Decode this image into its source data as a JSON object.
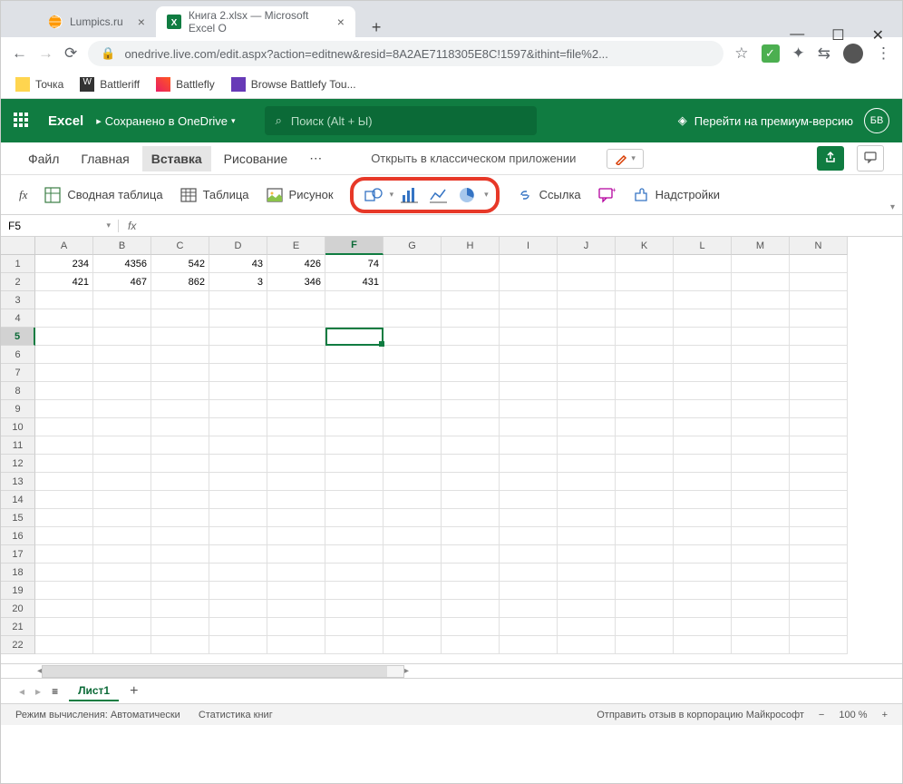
{
  "browser": {
    "tabs": [
      {
        "title": "Lumpics.ru",
        "active": false
      },
      {
        "title": "Книга 2.xlsx — Microsoft Excel O",
        "active": true
      }
    ],
    "url": "onedrive.live.com/edit.aspx?action=editnew&resid=8A2AE7118305E8C!1597&ithint=file%2...",
    "bookmarks": [
      {
        "label": "Точка"
      },
      {
        "label": "Battleriff"
      },
      {
        "label": "Battlefly"
      },
      {
        "label": "Browse Battlefy Tou..."
      }
    ]
  },
  "excel": {
    "app_name": "Excel",
    "saved_text": "Сохранено в OneDrive",
    "search_placeholder": "Поиск (Alt + Ы)",
    "premium_label": "Перейти на премиум-версию",
    "avatar_initials": "БВ"
  },
  "ribbon": {
    "tabs": [
      "Файл",
      "Главная",
      "Вставка",
      "Рисование"
    ],
    "active_tab": "Вставка",
    "open_classic": "Открыть в классическом приложении",
    "buttons": {
      "pivot": "Сводная таблица",
      "table": "Таблица",
      "picture": "Рисунок",
      "link": "Ссылка",
      "addins": "Надстройки"
    }
  },
  "formula": {
    "namebox": "F5",
    "fx_value": ""
  },
  "sheet": {
    "columns": [
      "A",
      "B",
      "C",
      "D",
      "E",
      "F",
      "G",
      "H",
      "I",
      "J",
      "K",
      "L",
      "M",
      "N"
    ],
    "row_count": 22,
    "data": {
      "1": {
        "A": "234",
        "B": "4356",
        "C": "542",
        "D": "43",
        "E": "426",
        "F": "74"
      },
      "2": {
        "A": "421",
        "B": "467",
        "C": "862",
        "D": "3",
        "E": "346",
        "F": "431"
      }
    },
    "selected": {
      "row": 5,
      "col": "F",
      "col_index": 5
    }
  },
  "sheettab": {
    "name": "Лист1"
  },
  "status": {
    "calc_mode": "Режим вычисления: Автоматически",
    "stats": "Статистика книг",
    "feedback": "Отправить отзыв в корпорацию Майкрософт",
    "zoom": "100 %"
  }
}
